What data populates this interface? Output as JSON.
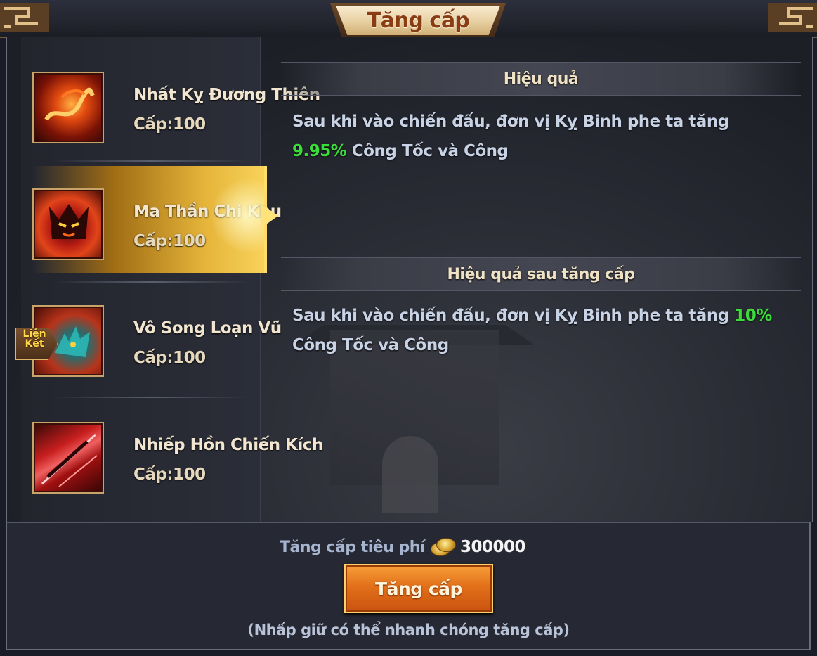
{
  "window": {
    "title": "Tăng cấp"
  },
  "skills": [
    {
      "name": "Nhất Kỵ Đương Thiên",
      "level": "Cấp:100",
      "selected": false,
      "badge": "",
      "icon": "fire-dragon-icon"
    },
    {
      "name": "Ma Thần Chi Khu",
      "level": "Cấp:100",
      "selected": true,
      "badge": "",
      "icon": "demon-face-icon"
    },
    {
      "name": "Vô Song Loạn Vũ",
      "level": "Cấp:100",
      "selected": false,
      "badge": "Liên Kết",
      "icon": "beast-strike-icon"
    },
    {
      "name": "Nhiếp Hồn Chiến Kích",
      "level": "Cấp:100",
      "selected": false,
      "badge": "",
      "icon": "halberd-slash-icon"
    }
  ],
  "link_badge": {
    "line1": "Liên",
    "line2": "Kết"
  },
  "effect": {
    "header": "Hiệu quả",
    "text_before": "Sau khi vào chiến đấu, đơn vị Kỵ Binh phe ta tăng ",
    "value": "9.95%",
    "text_after": " Công Tốc và Công"
  },
  "effect_after": {
    "header": "Hiệu quả sau tăng cấp",
    "text_before": "Sau khi vào chiến đấu, đơn vị Kỵ Binh phe ta tăng ",
    "value": "10%",
    "text_after": " Công Tốc và Công"
  },
  "cost": {
    "label": "Tăng cấp tiêu phí",
    "icon": "copper-coin-icon",
    "value": "300000"
  },
  "upgrade_button": {
    "label": "Tăng cấp"
  },
  "hint": "(Nhấp giữ có thể nhanh chóng tăng cấp)",
  "colors": {
    "highlight": "#3cdc3c",
    "accent_gold": "#f8d25a",
    "button": "#e2701a"
  }
}
